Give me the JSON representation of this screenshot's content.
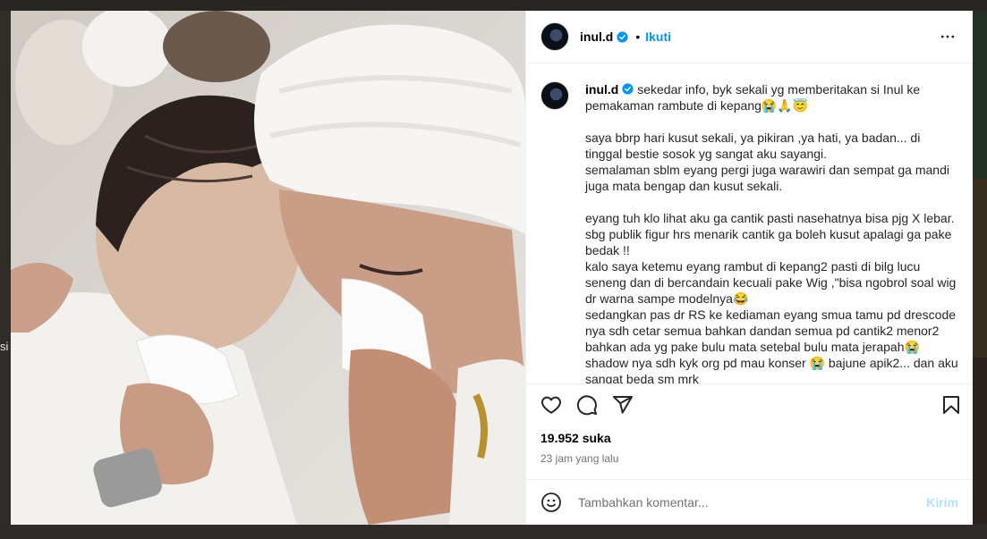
{
  "background": {
    "side_text": "si"
  },
  "post": {
    "username": "inul.d",
    "follow_label": "Ikuti",
    "separator": "•",
    "caption": "sekedar info, byk sekali yg memberitakan si Inul ke pemakaman rambute di kepang😭🙏😇\n\nsaya bbrp hari kusut sekali, ya pikiran ,ya hati, ya badan... di tinggal bestie sosok yg sangat aku sayangi.\nsemalaman sblm eyang pergi juga warawiri dan sempat ga mandi juga mata bengap dan kusut sekali.\n\neyang tuh klo lihat aku ga cantik pasti nasehatnya bisa pjg X lebar. sbg publik figur hrs menarik cantik ga boleh kusut apalagi ga pake bedak !!\nkalo saya ketemu eyang rambut di kepang2 pasti di bilg lucu seneng dan di bercandain kecuali pake Wig ,\"bisa ngobrol soal wig dr warna sampe modelnya😂\nsedangkan pas dr RS ke kediaman eyang smua tamu pd drescode nya sdh cetar semua bahkan dandan semua pd cantik2 menor2 bahkan ada yg pake bulu mata setebal bulu mata jerapah😭\nshadow nya sdh kyk org pd mau konser 😭 bajune apik2... dan aku sangat beda sm mrk",
    "likes": "19.952 suka",
    "timestamp": "23 jam yang lalu"
  },
  "comment_box": {
    "placeholder": "Tambahkan komentar...",
    "post_label": "Kirim"
  },
  "icons": [
    "more-options-icon",
    "verified-icon",
    "heart-icon",
    "comment-icon",
    "share-icon",
    "bookmark-icon",
    "emoji-icon"
  ],
  "colors": {
    "accent": "#0095f6",
    "post_disabled": "#b2dffc",
    "secondary_text": "#737373"
  }
}
